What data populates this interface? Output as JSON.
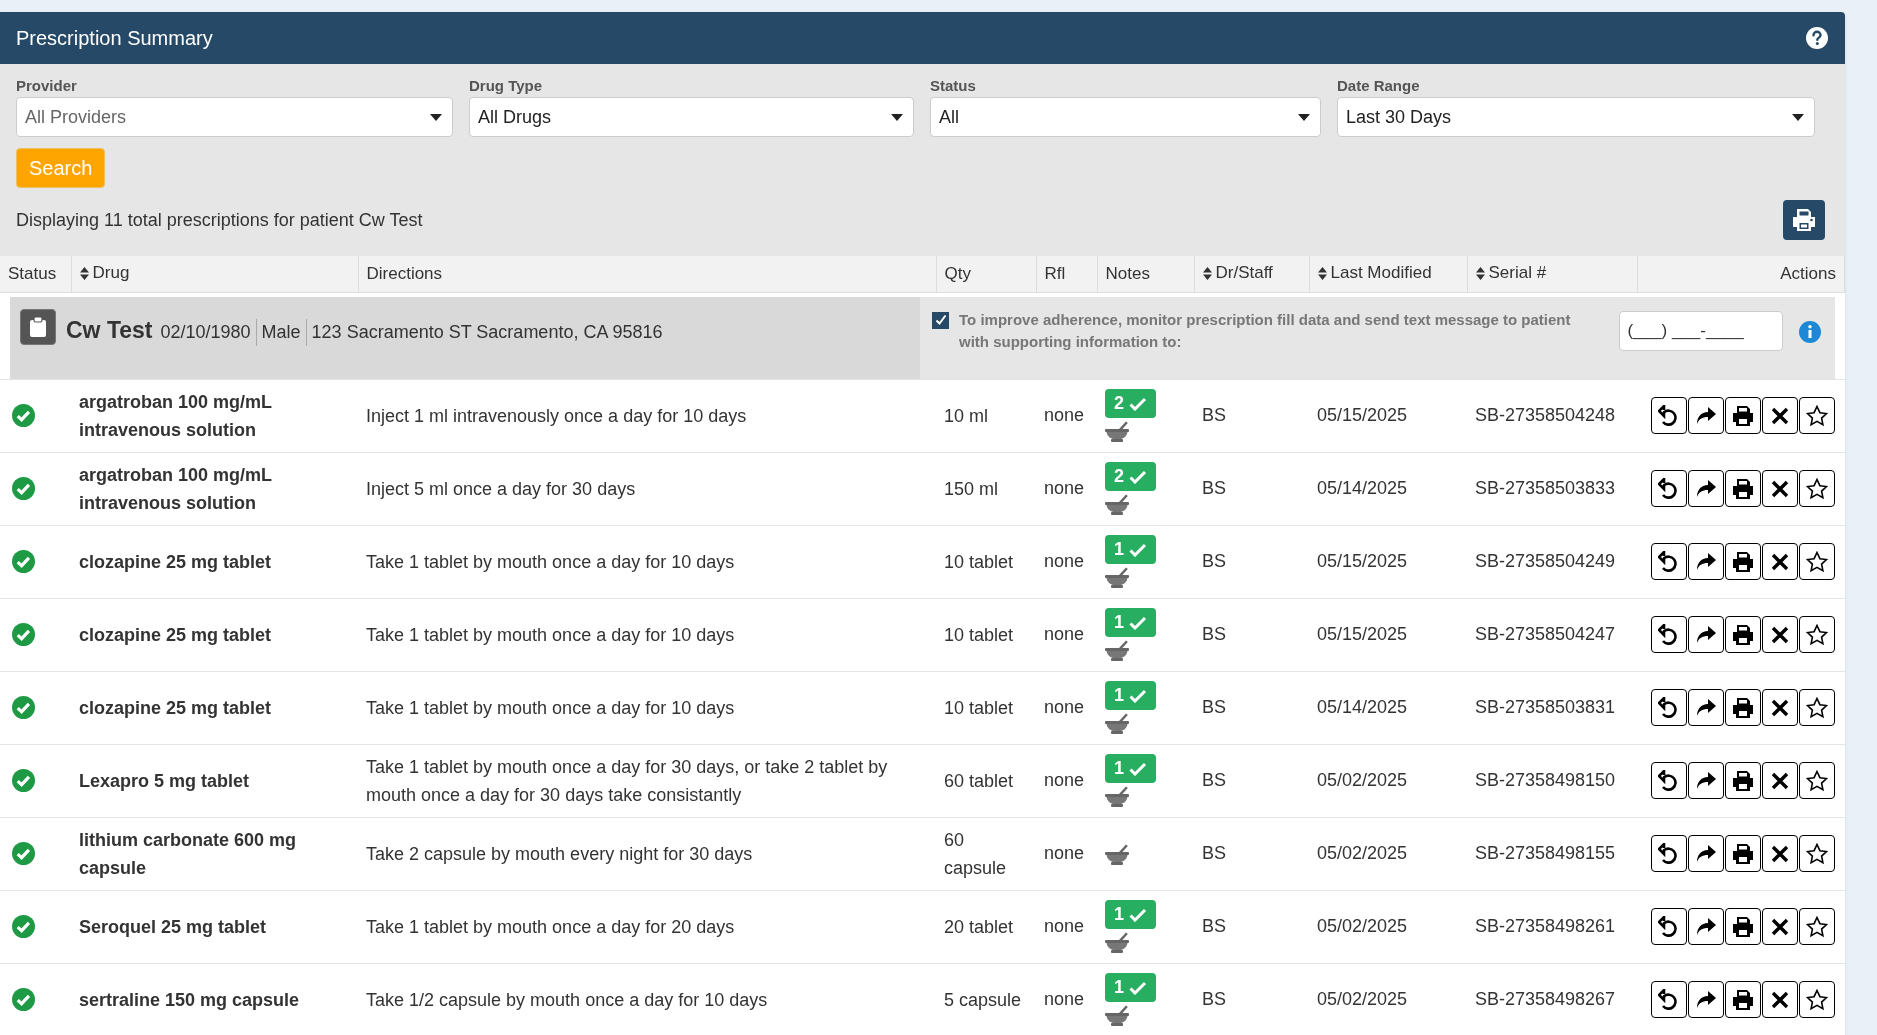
{
  "panel": {
    "title": "Prescription Summary"
  },
  "filters": [
    {
      "label": "Provider",
      "value": "All Providers",
      "placeholder_look": true
    },
    {
      "label": "Drug Type",
      "value": "All Drugs",
      "placeholder_look": false
    },
    {
      "label": "Status",
      "value": "All",
      "placeholder_look": false
    },
    {
      "label": "Date Range",
      "value": "Last 30 Days",
      "placeholder_look": false
    }
  ],
  "search_button": "Search",
  "summary": "Displaying 11 total prescriptions for patient Cw Test",
  "columns": [
    {
      "label": "Status",
      "sortable": false
    },
    {
      "label": "Drug",
      "sortable": true
    },
    {
      "label": "Directions",
      "sortable": false
    },
    {
      "label": "Qty",
      "sortable": false
    },
    {
      "label": "Rfl",
      "sortable": false
    },
    {
      "label": "Notes",
      "sortable": false
    },
    {
      "label": "Dr/Staff",
      "sortable": true
    },
    {
      "label": "Last Modified",
      "sortable": true
    },
    {
      "label": "Serial #",
      "sortable": true
    },
    {
      "label": "Actions",
      "sortable": false
    }
  ],
  "patient": {
    "name": "Cw Test",
    "dob": "02/10/1980",
    "sex": "Male",
    "address": "123 Sacramento ST Sacramento, CA 95816",
    "adherence_checked": true,
    "adherence_text": "To improve adherence, monitor prescription fill data and send text message to patient with supporting information to:",
    "phone_placeholder": "(___) ___-____"
  },
  "rows": [
    {
      "kind": "complete",
      "drug": "argatroban 100 mg/mL intravenous solution",
      "directions": "Inject 1 ml intravenously once a day for 10 days",
      "qty": "10 ml",
      "rfl": "none",
      "fills": "2",
      "staff": "BS",
      "modified": "05/15/2025",
      "serial": "SB-27358504248"
    },
    {
      "kind": "complete",
      "drug": "argatroban 100 mg/mL intravenous solution",
      "directions": "Inject 5 ml once a day for 30 days",
      "qty": "150 ml",
      "rfl": "none",
      "fills": "2",
      "staff": "BS",
      "modified": "05/14/2025",
      "serial": "SB-27358503833"
    },
    {
      "kind": "complete",
      "drug": "clozapine 25 mg tablet",
      "directions": "Take 1 tablet by mouth once a day for 10 days",
      "qty": "10 tablet",
      "rfl": "none",
      "fills": "1",
      "staff": "BS",
      "modified": "05/15/2025",
      "serial": "SB-27358504249"
    },
    {
      "kind": "complete",
      "drug": "clozapine 25 mg tablet",
      "directions": "Take 1 tablet by mouth once a day for 10 days",
      "qty": "10 tablet",
      "rfl": "none",
      "fills": "1",
      "staff": "BS",
      "modified": "05/15/2025",
      "serial": "SB-27358504247"
    },
    {
      "kind": "complete",
      "drug": "clozapine 25 mg tablet",
      "directions": "Take 1 tablet by mouth once a day for 10 days",
      "qty": "10 tablet",
      "rfl": "none",
      "fills": "1",
      "staff": "BS",
      "modified": "05/14/2025",
      "serial": "SB-27358503831"
    },
    {
      "kind": "complete",
      "drug": "Lexapro 5 mg tablet",
      "directions": "Take 1 tablet by mouth once a day for 30 days, or take 2 tablet by mouth once a day for 30 days take consistantly",
      "qty": "60 tablet",
      "rfl": "none",
      "fills": "1",
      "staff": "BS",
      "modified": "05/02/2025",
      "serial": "SB-27358498150"
    },
    {
      "kind": "complete",
      "drug": "lithium carbonate 600 mg capsule",
      "directions": "Take 2 capsule by mouth every night for 30 days",
      "qty": "60 capsule",
      "rfl": "none",
      "staff": "BS",
      "modified": "05/02/2025",
      "serial": "SB-27358498155"
    },
    {
      "kind": "complete",
      "drug": "Seroquel 25 mg tablet",
      "directions": "Take 1 tablet by mouth once a day for 20 days",
      "qty": "20 tablet",
      "rfl": "none",
      "fills": "1",
      "staff": "BS",
      "modified": "05/02/2025",
      "serial": "SB-27358498261"
    },
    {
      "kind": "complete",
      "drug": "sertraline 150 mg capsule",
      "directions": "Take 1/2 capsule by mouth once a day for 10 days",
      "qty": "5 capsule",
      "rfl": "none",
      "fills": "1",
      "staff": "BS",
      "modified": "05/02/2025",
      "serial": "SB-27358498267"
    }
  ]
}
